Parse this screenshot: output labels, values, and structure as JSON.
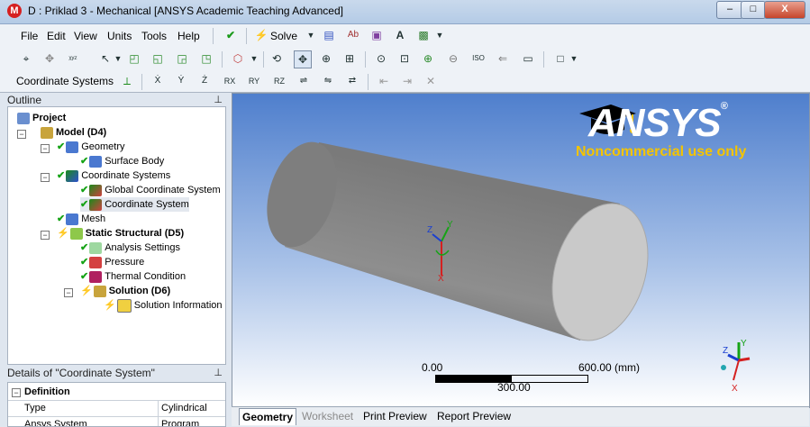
{
  "window": {
    "title": "D : Priklad 3 - Mechanical [ANSYS Academic Teaching Advanced]",
    "app_icon": "M",
    "minimize": "–",
    "maximize": "□",
    "close": "X"
  },
  "menu": [
    "File",
    "Edit",
    "View",
    "Units",
    "Tools",
    "Help"
  ],
  "toolbar": {
    "solve_label": "Solve",
    "row3_label": "Coordinate Systems"
  },
  "outline": {
    "header": "Outline",
    "pin": "⊥",
    "tree": [
      {
        "label": "Project",
        "bold": true
      },
      {
        "label": "Model (D4)",
        "bold": true
      },
      {
        "label": "Geometry",
        "bold": false
      },
      {
        "label": "Surface Body",
        "bold": false
      },
      {
        "label": "Coordinate Systems",
        "bold": false
      },
      {
        "label": "Global Coordinate System",
        "bold": false
      },
      {
        "label": "Coordinate System",
        "bold": false
      },
      {
        "label": "Mesh",
        "bold": false
      },
      {
        "label": "Static Structural (D5)",
        "bold": true
      },
      {
        "label": "Analysis Settings",
        "bold": false
      },
      {
        "label": "Pressure",
        "bold": false
      },
      {
        "label": "Thermal Condition",
        "bold": false
      },
      {
        "label": "Solution (D6)",
        "bold": true
      },
      {
        "label": "Solution Information",
        "bold": false
      }
    ]
  },
  "details": {
    "header": "Details of \"Coordinate System\"",
    "pin": "⊥",
    "section": "Definition",
    "rows": [
      {
        "name": "Type",
        "value": "Cylindrical"
      },
      {
        "name": "Ansys System",
        "value": "Program"
      }
    ]
  },
  "graphics": {
    "logo_text": "ANSYS",
    "logo_registered": "®",
    "watermark": "Noncommercial use only",
    "scale_left": "0.00",
    "scale_right": "600.00 (mm)",
    "scale_mid": "300.00",
    "axis_labels": {
      "x": "X",
      "y": "Y",
      "z": "Z"
    }
  },
  "tabs": [
    {
      "label": "Geometry",
      "state": "active"
    },
    {
      "label": "Worksheet",
      "state": "disabled"
    },
    {
      "label": "Print Preview",
      "state": "normal"
    },
    {
      "label": "Report Preview",
      "state": "normal"
    }
  ],
  "colors": {
    "accent": "#f4c400",
    "check": "#16a316",
    "triad_x": "#d42020",
    "triad_y": "#16a316",
    "triad_z": "#1a3fd0"
  }
}
